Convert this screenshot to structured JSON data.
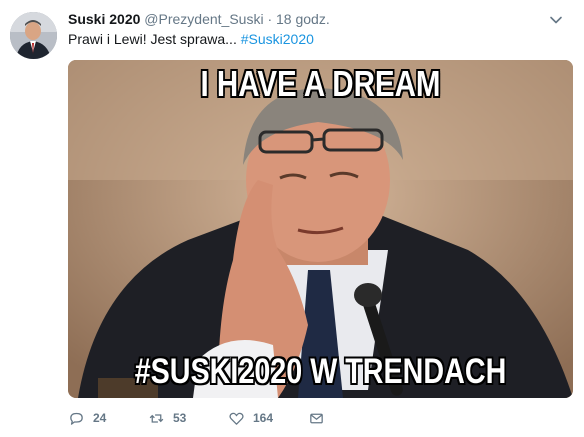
{
  "tweet": {
    "display_name": "Suski 2020",
    "handle": "@Prezydent_Suski",
    "separator": "·",
    "time": "18 godz.",
    "text": "Prawi i Lewi! Jest sprawa...",
    "hashtag": "#Suski2020"
  },
  "media": {
    "caption_top": "I HAVE A DREAM",
    "caption_bottom": "#SUSKI2020 W TRENDACH"
  },
  "actions": {
    "reply_count": "24",
    "retweet_count": "53",
    "like_count": "164"
  },
  "icons": {
    "reply": "reply-icon",
    "retweet": "retweet-icon",
    "like": "heart-icon",
    "dm": "envelope-icon",
    "menu": "chevron-down-icon"
  },
  "colors": {
    "link": "#1b95e0",
    "secondary_text": "#657786"
  }
}
